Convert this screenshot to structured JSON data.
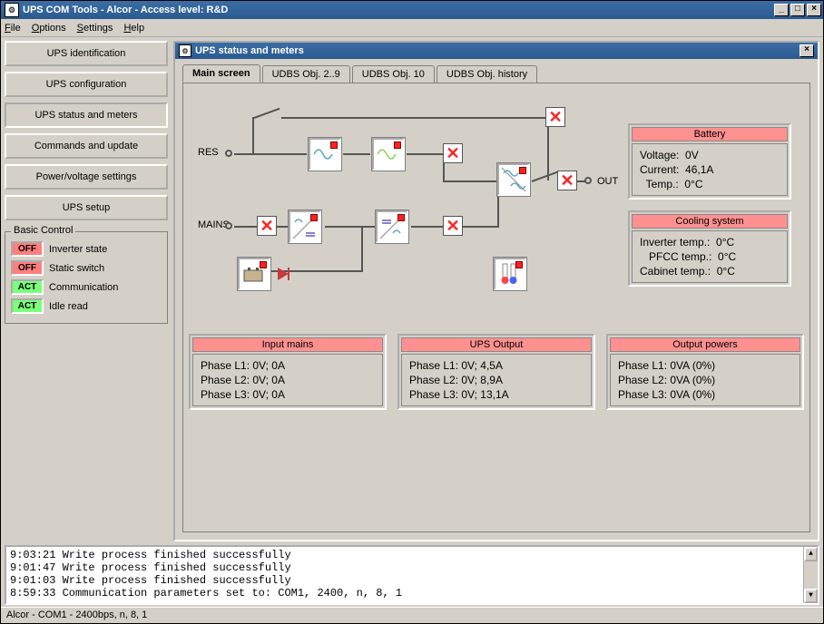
{
  "window": {
    "title": "UPS COM Tools - Alcor - Access level: R&D"
  },
  "menu": {
    "file": "File",
    "options": "Options",
    "settings": "Settings",
    "help": "Help"
  },
  "sidebar": {
    "buttons": {
      "ident": "UPS identification",
      "config": "UPS configuration",
      "status": "UPS status and meters",
      "commands": "Commands and update",
      "power": "Power/voltage settings",
      "setup": "UPS setup"
    }
  },
  "basic_control": {
    "title": "Basic Control",
    "items": [
      {
        "badge": "OFF",
        "cls": "off",
        "label": "Inverter state"
      },
      {
        "badge": "OFF",
        "cls": "off",
        "label": "Static switch"
      },
      {
        "badge": "ACT",
        "cls": "act",
        "label": "Communication"
      },
      {
        "badge": "ACT",
        "cls": "act",
        "label": "Idle read"
      }
    ]
  },
  "subwindow": {
    "title": "UPS status and meters"
  },
  "tabs": {
    "main": "Main screen",
    "udbs29": "UDBS Obj. 2..9",
    "udbs10": "UDBS Obj. 10",
    "hist": "UDBS Obj. history"
  },
  "diagram": {
    "res": "RES",
    "mains": "MAINS",
    "out": "OUT"
  },
  "battery": {
    "title": "Battery",
    "voltage_label": "Voltage:",
    "voltage_value": "0V",
    "current_label": "Current:",
    "current_value": "46,1A",
    "temp_label": "Temp.:",
    "temp_value": "0°C"
  },
  "cooling": {
    "title": "Cooling system",
    "inv_label": "Inverter temp.:",
    "inv_value": "0°C",
    "pfcc_label": "PFCC temp.:",
    "pfcc_value": "0°C",
    "cab_label": "Cabinet temp.:",
    "cab_value": "0°C"
  },
  "input_mains": {
    "title": "Input mains",
    "l1": "Phase L1:  0V; 0A",
    "l2": "Phase L2:  0V; 0A",
    "l3": "Phase L3:  0V; 0A"
  },
  "ups_output": {
    "title": "UPS Output",
    "l1": "Phase L1:  0V; 4,5A",
    "l2": "Phase L2:  0V; 8,9A",
    "l3": "Phase L3:  0V; 13,1A"
  },
  "output_powers": {
    "title": "Output powers",
    "l1": "Phase L1:  0VA (0%)",
    "l2": "Phase L2:  0VA (0%)",
    "l3": "Phase L3:  0VA (0%)"
  },
  "log": {
    "l1": "9:03:21 Write process finished successfully",
    "l2": "9:01:47 Write process finished successfully",
    "l3": "9:01:03 Write process finished successfully",
    "l4": "8:59:33 Communication parameters set to: COM1, 2400, n, 8, 1"
  },
  "status": "Alcor - COM1 - 2400bps, n, 8, 1"
}
